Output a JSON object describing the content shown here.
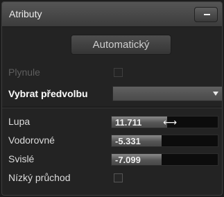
{
  "panel": {
    "title": "Atributy",
    "collapse_icon": "minus-icon"
  },
  "auto_button": {
    "label": "Automatický"
  },
  "smooth": {
    "label": "Plynule",
    "checked": false,
    "enabled": false
  },
  "preset": {
    "label": "Vybrat předvolbu",
    "selected": "",
    "arrow_icon": "chevron-down-icon"
  },
  "sliders": [
    {
      "label": "Lupa",
      "value": "11.711",
      "fill": 0.52
    },
    {
      "label": "Vodorovné",
      "value": "-5.331",
      "fill": 0.47
    },
    {
      "label": "Svislé",
      "value": "-7.099",
      "fill": 0.47
    }
  ],
  "lowpass": {
    "label": "Nízký průchod",
    "checked": false
  },
  "cursor_icon": "resize-horizontal-icon"
}
